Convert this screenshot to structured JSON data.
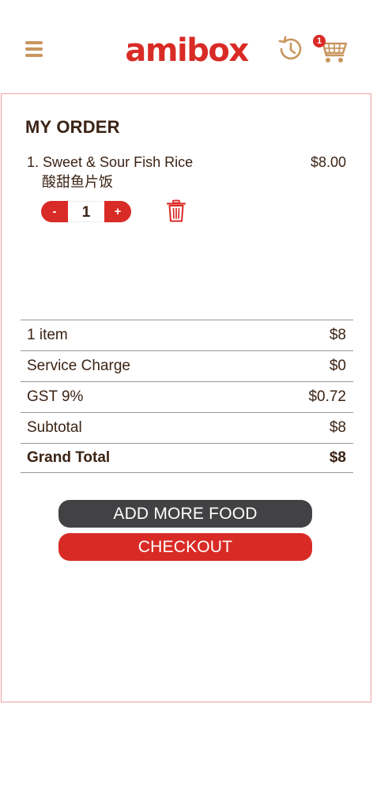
{
  "header": {
    "logo_text": "amibox",
    "cart_count": "1",
    "menu_icon": "hamburger-menu-icon",
    "history_icon": "history-icon",
    "cart_icon": "shopping-cart-icon"
  },
  "order": {
    "title": "MY ORDER",
    "items": [
      {
        "name": "1. Sweet & Sour Fish Rice",
        "name_cn": "酸甜鱼片饭",
        "price": "$8.00",
        "quantity": "1",
        "minus_label": "-",
        "plus_label": "+"
      }
    ]
  },
  "summary": [
    {
      "label": "1 item",
      "value": "$8"
    },
    {
      "label": "Service Charge",
      "value": "$0"
    },
    {
      "label": "GST 9%",
      "value": "$0.72"
    },
    {
      "label": "Subtotal",
      "value": "$8"
    },
    {
      "label": "Grand Total",
      "value": "$8"
    }
  ],
  "actions": {
    "add_more": "ADD MORE FOOD",
    "checkout": "CHECKOUT"
  },
  "colors": {
    "brand_red": "#d92b26",
    "gold": "#c8965e",
    "dark_brown": "#3b2314",
    "dark_button": "#424143"
  }
}
